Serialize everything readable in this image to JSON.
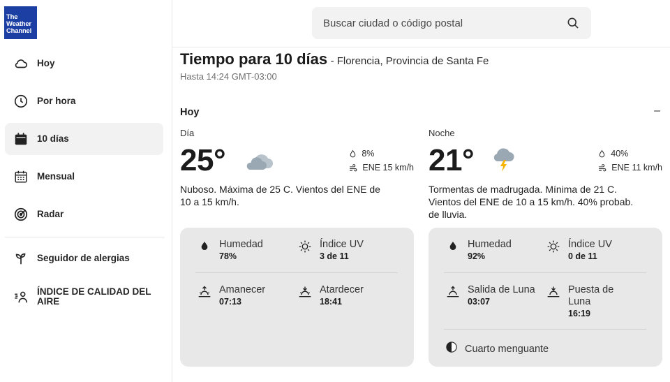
{
  "brand": {
    "line1": "The",
    "line2": "Weather",
    "line3": "Channel",
    "color": "#1c3fa4"
  },
  "search": {
    "placeholder": "Buscar ciudad o código postal"
  },
  "sidebar": {
    "items": [
      {
        "label": "Hoy",
        "icon": "cloud-icon"
      },
      {
        "label": "Por hora",
        "icon": "clock-icon"
      },
      {
        "label": "10 días",
        "icon": "calendar-icon",
        "active": true
      },
      {
        "label": "Mensual",
        "icon": "calendar-grid-icon"
      },
      {
        "label": "Radar",
        "icon": "radar-icon"
      },
      {
        "label": "Seguidor de alergias",
        "icon": "plant-icon"
      },
      {
        "label": "ÍNDICE DE CALIDAD DEL AIRE",
        "icon": "air-quality-icon"
      }
    ]
  },
  "page": {
    "title": "Tiempo para 10 días",
    "location": "- Florencia, Provincia de Santa Fe",
    "updated": "Hasta 14:24 GMT-03:00",
    "section": "Hoy",
    "collapse_symbol": "–"
  },
  "day": {
    "period": "Día",
    "temp": "25°",
    "icon": "cloudy-icon",
    "precip": "8%",
    "wind": "ENE 15 km/h",
    "description": "Nuboso. Máxima de 25 C. Vientos del ENE de 10 a 15 km/h.",
    "details": {
      "humidity_label": "Humedad",
      "humidity": "78%",
      "uv_label": "Índice UV",
      "uv": "3 de 11",
      "sunrise_label": "Amanecer",
      "sunrise": "07:13",
      "sunset_label": "Atardecer",
      "sunset": "18:41"
    }
  },
  "night": {
    "period": "Noche",
    "temp": "21°",
    "icon": "thunderstorm-icon",
    "precip": "40%",
    "wind": "ENE 11 km/h",
    "description": "Tormentas de madrugada. Mínima de 21 C. Vientos del ENE de 10 a 15 km/h. 40% probab. de lluvia.",
    "details": {
      "humidity_label": "Humedad",
      "humidity": "92%",
      "uv_label": "Índice UV",
      "uv": "0 de 11",
      "moonrise_label": "Salida de Luna",
      "moonrise": "03:07",
      "moonset_label": "Puesta de Luna",
      "moonset": "16:19",
      "moon_phase": "Cuarto menguante"
    }
  }
}
